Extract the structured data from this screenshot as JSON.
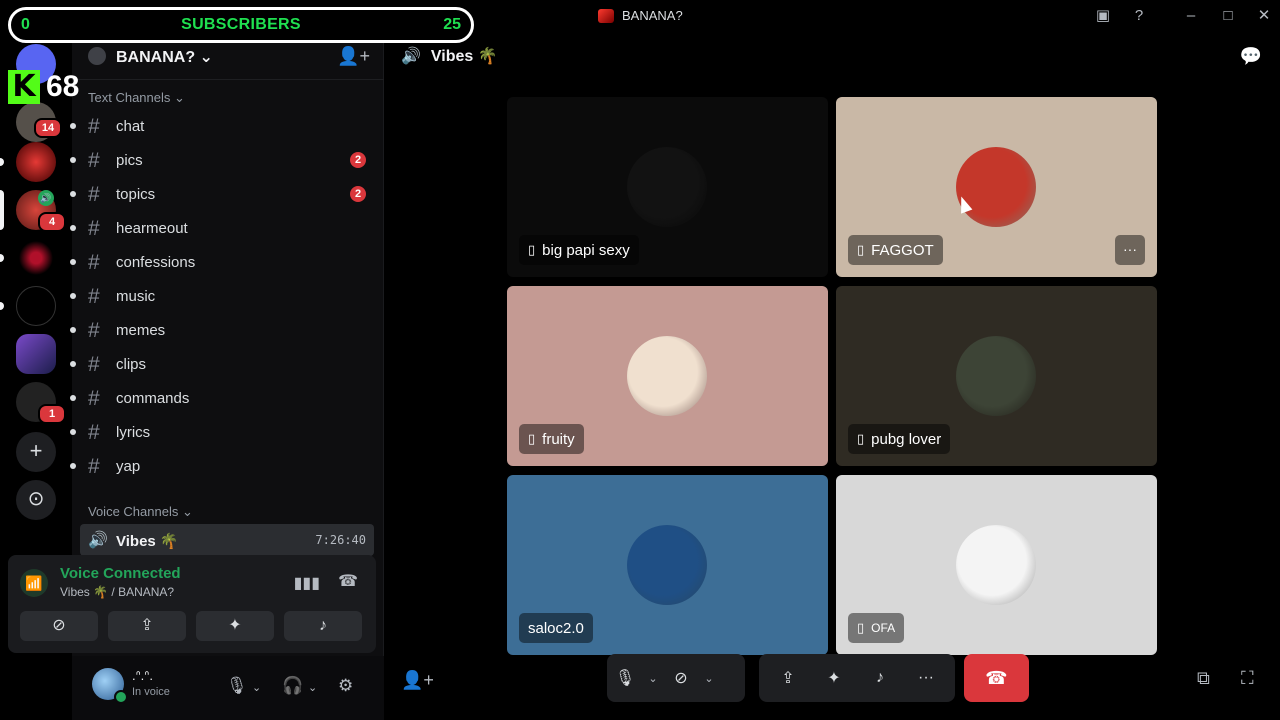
{
  "overlay": {
    "subscribers_left": "0",
    "subscribers_label": "SUBSCRIBERS",
    "subscribers_right": "25",
    "kick_letter": "K",
    "kick_count": "68"
  },
  "window": {
    "title": "BANANA?",
    "icons": [
      "inbox-icon",
      "help-icon",
      "minimize-icon",
      "maximize-icon",
      "close-icon"
    ]
  },
  "rail": {
    "badges": [
      "14",
      "4",
      "1"
    ],
    "add_label": "+",
    "explore_label": "⊙"
  },
  "server": {
    "name": "BANANA? ⌄",
    "text_category": "Text Channels ⌄",
    "voice_category": "Voice Channels ⌄",
    "channels": [
      {
        "label": "chat",
        "count": ""
      },
      {
        "label": "pics",
        "count": "2"
      },
      {
        "label": "topics",
        "count": "2"
      },
      {
        "label": "hearmeout",
        "count": ""
      },
      {
        "label": "confessions",
        "count": ""
      },
      {
        "label": "music",
        "count": ""
      },
      {
        "label": "memes",
        "count": ""
      },
      {
        "label": "clips",
        "count": ""
      },
      {
        "label": "commands",
        "count": ""
      },
      {
        "label": "lyrics",
        "count": ""
      },
      {
        "label": "yap",
        "count": ""
      }
    ],
    "voice_channel": {
      "label": "Vibes 🌴",
      "time": "7:26:40"
    }
  },
  "voice_panel": {
    "status": "Voice Connected",
    "location": "Vibes 🌴 / BANANA?"
  },
  "user_panel": {
    "name": ".ᐢ.ᐢ.",
    "status": "In voice"
  },
  "stage": {
    "channel": "Vibes 🌴",
    "tiles": [
      {
        "name": "big papi sexy",
        "bg": "#0b0b0b",
        "av": "#121212",
        "phone": true
      },
      {
        "name": "FAGGOT",
        "bg": "#c9b8a6",
        "av": "#c4372a",
        "phone": true,
        "more": "···"
      },
      {
        "name": "fruity",
        "bg": "#c49a93",
        "av": "#f0e0cf",
        "phone": true
      },
      {
        "name": "pubg lover",
        "bg": "#2f2b23",
        "av": "#3d4436",
        "phone": true
      },
      {
        "name": "saloc2.0",
        "bg": "#3d6e96",
        "av": "#1f4f85",
        "phone": false
      },
      {
        "name": "OFA",
        "bg": "#d8d8d8",
        "av": "#f4f4f4",
        "phone": true
      }
    ]
  },
  "colors": {
    "accent_green": "#23a55a",
    "danger_red": "#da373c",
    "overlay_green": "#1fe050",
    "kick_green": "#53fc18"
  }
}
